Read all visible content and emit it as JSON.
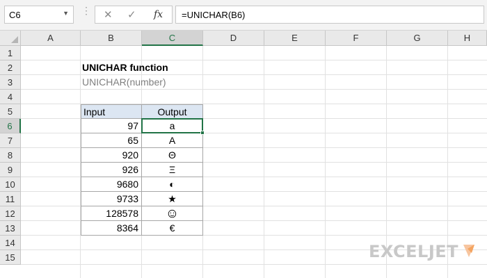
{
  "formula_bar": {
    "name_box": "C6",
    "formula": "=UNICHAR(B6)",
    "fx_label": "fx"
  },
  "columns": [
    "A",
    "B",
    "C",
    "D",
    "E",
    "F",
    "G",
    "H"
  ],
  "rows": [
    "1",
    "2",
    "3",
    "4",
    "5",
    "6",
    "7",
    "8",
    "9",
    "10",
    "11",
    "12",
    "13",
    "14",
    "15"
  ],
  "selected_column": "C",
  "selected_row": "6",
  "sheet": {
    "title": "UNICHAR function",
    "subtitle": "UNICHAR(number)"
  },
  "table": {
    "headers": [
      "Input",
      "Output"
    ],
    "rows": [
      {
        "input": "97",
        "output": "a"
      },
      {
        "input": "65",
        "output": "A"
      },
      {
        "input": "920",
        "output": "Θ"
      },
      {
        "input": "926",
        "output": "Ξ"
      },
      {
        "input": "9680",
        "output": "◐"
      },
      {
        "input": "9733",
        "output": "★"
      },
      {
        "input": "128578",
        "output": "☺"
      },
      {
        "input": "8364",
        "output": "€"
      }
    ]
  },
  "logo": {
    "text": "EXCELJET"
  },
  "colors": {
    "accent": "#217346",
    "header_fill": "#dce6f2",
    "logo_orange": "#f4a460"
  }
}
